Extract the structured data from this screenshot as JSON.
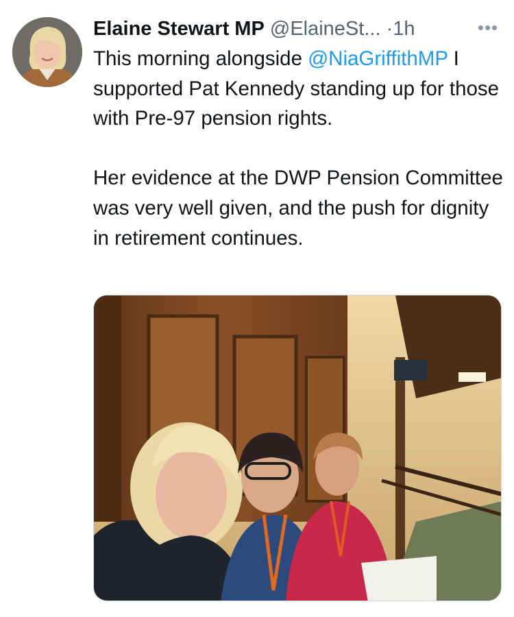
{
  "tweet": {
    "author_name": "Elaine Stewart MP",
    "author_handle": "@ElaineSt...",
    "separator": "·",
    "time": "1h",
    "more_icon": "more-horizontal-icon",
    "text": {
      "line1_prefix": "This morning alongside ",
      "mention": "@NiaGriffithMP",
      "line1_suffix": " I supported Pat Kennedy standing up for those with Pre-97 pension rights.",
      "paragraph2": "Her evidence at the DWP Pension Committee was very well given, and the push for dignity in retirement continues."
    }
  },
  "colors": {
    "text": "#0f1419",
    "muted": "#536471",
    "mention": "#1d9bf0"
  }
}
